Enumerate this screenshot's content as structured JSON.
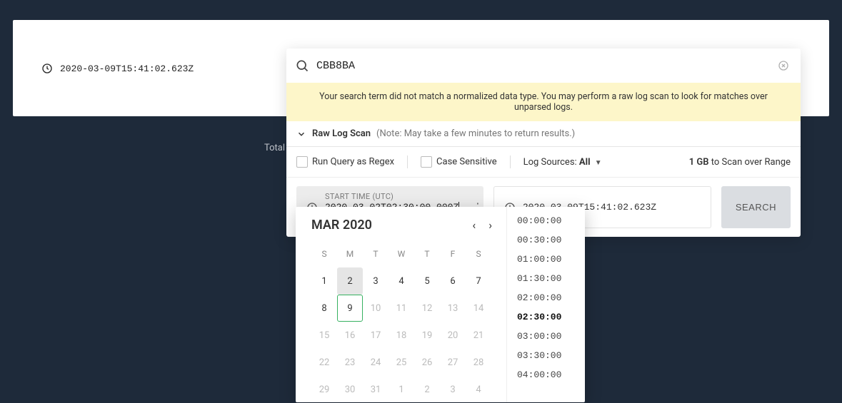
{
  "main": {
    "timestamp": "2020-03-09T15:41:02.623Z",
    "bg_label": "Total L"
  },
  "search": {
    "query": "CBB8BA",
    "warning": "Your search term did not match a normalized data type. You may perform a raw log scan to look for matches over unparsed logs.",
    "raw_log_label": "Raw Log Scan",
    "raw_log_note": "(Note: May take a few minutes to return results.)",
    "regex_label": "Run Query as Regex",
    "case_label": "Case Sensitive",
    "sources_label": "Log Sources:",
    "sources_value": "All",
    "scan_size": "1 GB",
    "scan_suffix": "to Scan over Range",
    "start": {
      "label": "START TIME (UTC)",
      "value": "2020-03-02T02:30:00.000Z",
      "hint": "2020-03-02T02:30:00.000Z"
    },
    "end_value": "2020-03-09T15:41:02.623Z",
    "button": "SEARCH"
  },
  "calendar": {
    "title": "MAR 2020",
    "dows": [
      "S",
      "M",
      "T",
      "W",
      "T",
      "F",
      "S"
    ],
    "selected_day": 2,
    "today": 9,
    "weeks": [
      [
        {
          "n": 1
        },
        {
          "n": 2
        },
        {
          "n": 3
        },
        {
          "n": 4
        },
        {
          "n": 5
        },
        {
          "n": 6
        },
        {
          "n": 7
        }
      ],
      [
        {
          "n": 8
        },
        {
          "n": 9
        },
        {
          "n": 10,
          "m": true
        },
        {
          "n": 11,
          "m": true
        },
        {
          "n": 12,
          "m": true
        },
        {
          "n": 13,
          "m": true
        },
        {
          "n": 14,
          "m": true
        }
      ],
      [
        {
          "n": 15,
          "m": true
        },
        {
          "n": 16,
          "m": true
        },
        {
          "n": 17,
          "m": true
        },
        {
          "n": 18,
          "m": true
        },
        {
          "n": 19,
          "m": true
        },
        {
          "n": 20,
          "m": true
        },
        {
          "n": 21,
          "m": true
        }
      ],
      [
        {
          "n": 22,
          "m": true
        },
        {
          "n": 23,
          "m": true
        },
        {
          "n": 24,
          "m": true
        },
        {
          "n": 25,
          "m": true
        },
        {
          "n": 26,
          "m": true
        },
        {
          "n": 27,
          "m": true
        },
        {
          "n": 28,
          "m": true
        }
      ],
      [
        {
          "n": 29,
          "m": true
        },
        {
          "n": 30,
          "m": true
        },
        {
          "n": 31,
          "m": true
        },
        {
          "n": 1,
          "m": true
        },
        {
          "n": 2,
          "m": true
        },
        {
          "n": 3,
          "m": true
        },
        {
          "n": 4,
          "m": true
        }
      ]
    ],
    "times": [
      "00:00:00",
      "00:30:00",
      "01:00:00",
      "01:30:00",
      "02:00:00",
      "02:30:00",
      "03:00:00",
      "03:30:00",
      "04:00:00"
    ],
    "selected_time": "02:30:00"
  }
}
